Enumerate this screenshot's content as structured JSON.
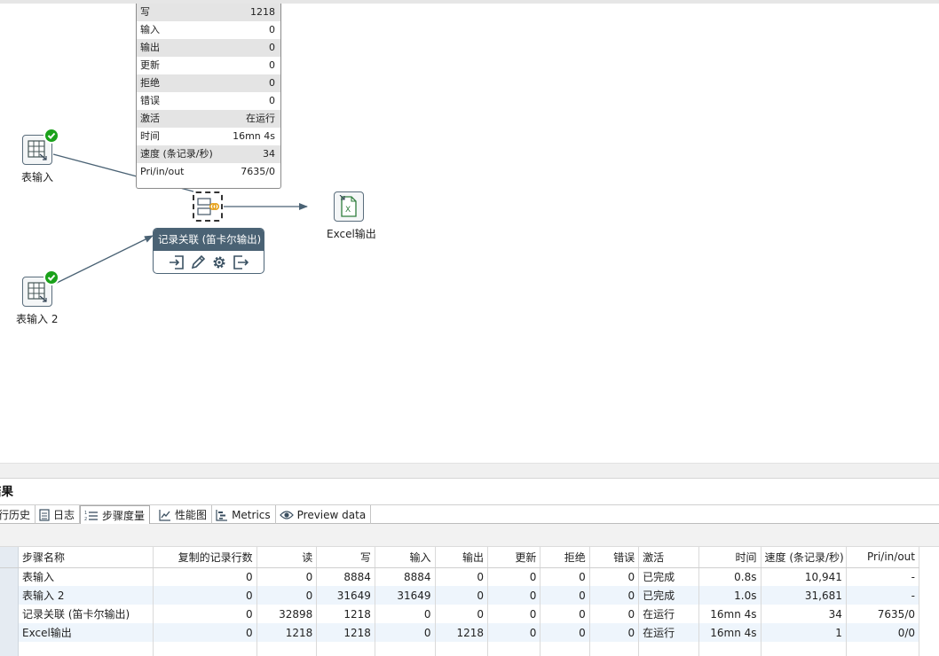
{
  "canvas": {
    "steps": {
      "table_input_1": "表输入",
      "table_input_2": "表输入 2",
      "excel_output": "Excel输出"
    },
    "tooltip": [
      {
        "label": "写",
        "value": "1218"
      },
      {
        "label": "输入",
        "value": "0"
      },
      {
        "label": "输出",
        "value": "0"
      },
      {
        "label": "更新",
        "value": "0"
      },
      {
        "label": "拒绝",
        "value": "0"
      },
      {
        "label": "错误",
        "value": "0"
      },
      {
        "label": "激活",
        "value": "在运行"
      },
      {
        "label": "时间",
        "value": "16mn 4s"
      },
      {
        "label": "速度 (条记录/秒)",
        "value": "34"
      },
      {
        "label": "Pri/in/out",
        "value": "7635/0"
      }
    ],
    "popup_title": "记录关联 (笛卡尔输出)"
  },
  "results": {
    "title": "结果",
    "tabs": [
      "行历史",
      "日志",
      "步骤度量",
      "性能图",
      "Metrics",
      "Preview data"
    ],
    "columns": [
      "步骤名称",
      "复制的记录行数",
      "读",
      "写",
      "输入",
      "输出",
      "更新",
      "拒绝",
      "错误",
      "激活",
      "时间",
      "速度 (条记录/秒)",
      "Pri/in/out"
    ],
    "rows": [
      [
        "表输入",
        "0",
        "0",
        "8884",
        "8884",
        "0",
        "0",
        "0",
        "0",
        "已完成",
        "0.8s",
        "10,941",
        "-"
      ],
      [
        "表输入 2",
        "0",
        "0",
        "31649",
        "31649",
        "0",
        "0",
        "0",
        "0",
        "已完成",
        "1.0s",
        "31,681",
        "-"
      ],
      [
        "记录关联 (笛卡尔输出)",
        "0",
        "32898",
        "1218",
        "0",
        "0",
        "0",
        "0",
        "0",
        "在运行",
        "16mn 4s",
        "34",
        "7635/0"
      ],
      [
        "Excel输出",
        "0",
        "1218",
        "1218",
        "0",
        "1218",
        "0",
        "0",
        "0",
        "在运行",
        "16mn 4s",
        "1",
        "0/0"
      ]
    ]
  },
  "colors": {
    "accent": "#4a6274",
    "ok": "#1aa11a",
    "row_alt": "#eef5fc"
  }
}
